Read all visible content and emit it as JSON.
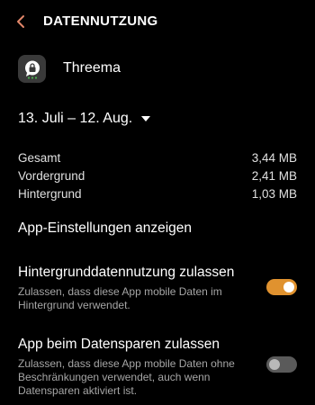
{
  "header": {
    "title": "DATENNUTZUNG"
  },
  "app": {
    "name": "Threema"
  },
  "period": {
    "label": "13. Juli – 12. Aug."
  },
  "usage": [
    {
      "label": "Gesamt",
      "value": "3,44 MB"
    },
    {
      "label": "Vordergrund",
      "value": "2,41 MB"
    },
    {
      "label": "Hintergrund",
      "value": "1,03 MB"
    }
  ],
  "settings_link": "App-Einstellungen anzeigen",
  "background_data": {
    "title": "Hintergrunddatennutzung zulassen",
    "description": "Zulassen, dass diese App mobile Daten im Hintergrund verwendet.",
    "enabled": true
  },
  "data_saver": {
    "title": "App beim Datensparen zulassen",
    "description": "Zulassen, dass diese App mobile Daten ohne Beschränkungen verwendet, auch wenn Datensparen aktiviert ist.",
    "enabled": false
  },
  "colors": {
    "accent": "#d98a3c",
    "switch_on_track": "#e0922f",
    "switch_off_track": "#5a5a5a",
    "switch_off_thumb": "#b8b8b8",
    "back_arrow": "#e2876a",
    "secondary_text": "#a6a6a6"
  },
  "icons": {
    "back": "back-arrow-icon",
    "app": "threema-app-icon",
    "dropdown": "dropdown-triangle-icon"
  }
}
